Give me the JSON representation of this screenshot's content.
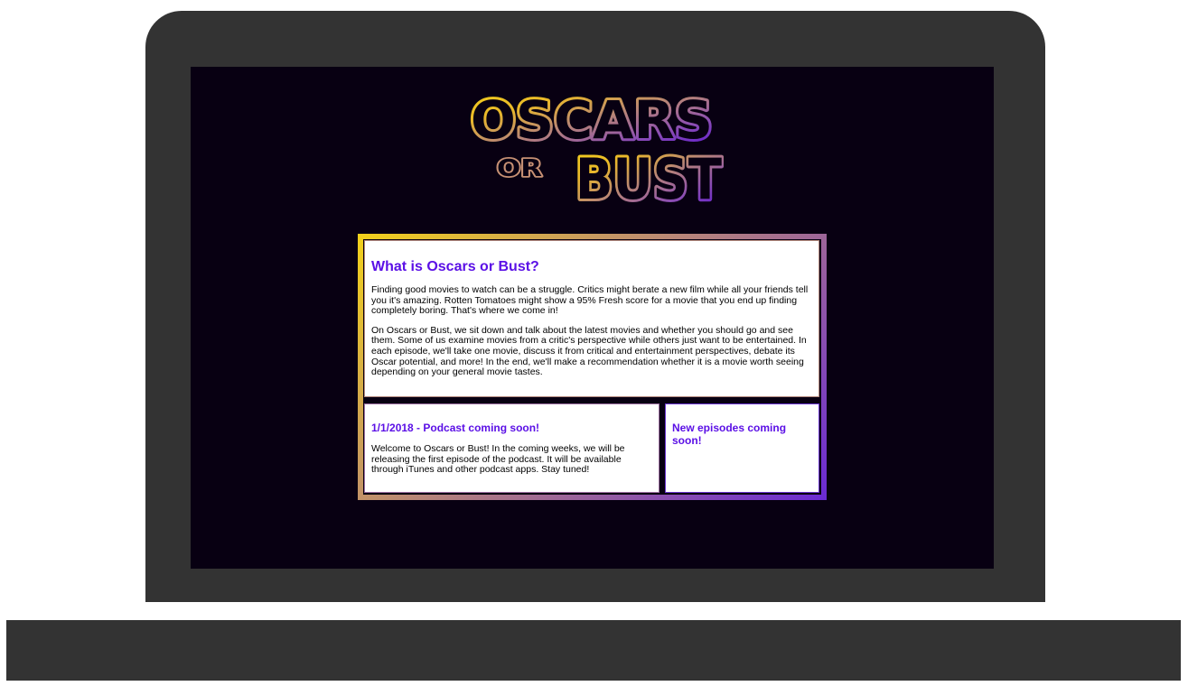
{
  "logo": {
    "line1": "OSCARS",
    "connector": "OR",
    "line2": "BUST"
  },
  "intro": {
    "heading": "What is Oscars or Bust?",
    "paragraph1": "Finding good movies to watch can be a struggle. Critics might berate a new film while all your friends tell you it's amazing. Rotten Tomatoes might show a 95% Fresh score for a movie that you end up finding completely boring. That's where we come in!",
    "paragraph2": "On Oscars or Bust, we sit down and talk about the latest movies and whether you should go and see them. Some of us examine movies from a critic's perspective while others just want to be entertained. In each episode, we'll take one movie, discuss it from critical and entertainment perspectives, debate its Oscar potential, and more! In the end, we'll make a recommendation whether it is a movie worth seeing depending on your general movie tastes."
  },
  "news": {
    "heading": "1/1/2018 - Podcast coming soon!",
    "body": "Welcome to Oscars or Bust! In the coming weeks, we will be releasing the first episode of the podcast. It will be available through iTunes and other podcast apps. Stay tuned!"
  },
  "episodes": {
    "heading": "New episodes coming soon!"
  },
  "colors": {
    "screen_background": "#080012",
    "device_body": "#333333",
    "heading_purple": "#5b10e6",
    "logo_gold": "#f3d21a",
    "logo_purple": "#5a14d6"
  }
}
